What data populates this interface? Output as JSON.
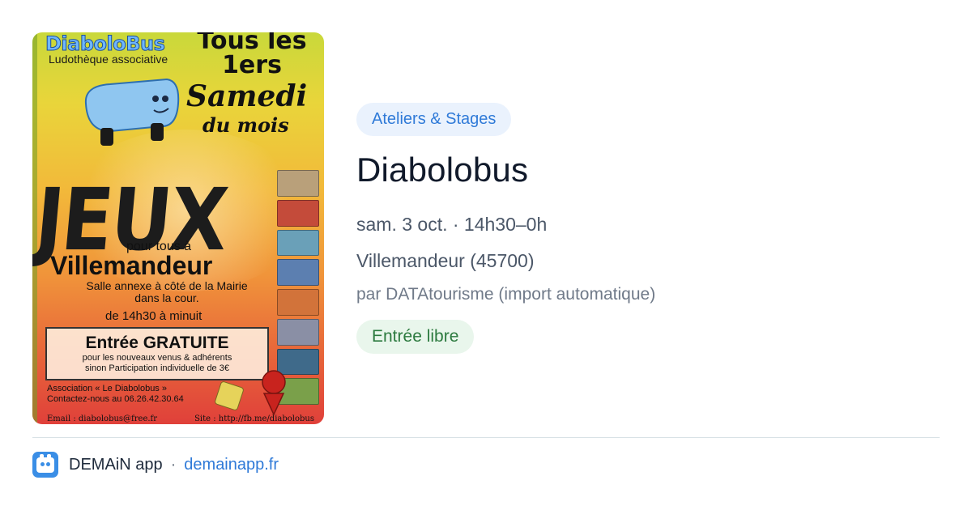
{
  "poster": {
    "logo_text": "DiaboloBus",
    "subtitle": "Ludothèque associative",
    "when_line1": "Tous les",
    "when_line2": "1ers",
    "when_line3": "Samedi",
    "when_line4": "du mois",
    "headline": "JEUX",
    "for_all": "pour tous à",
    "town": "Villemandeur",
    "venue_line1": "Salle annexe à côté de la Mairie",
    "venue_line2": "dans la cour.",
    "hours": "de 14h30 à minuit",
    "entry_title": "Entrée GRATUITE",
    "entry_line1": "pour les nouveaux venus & adhérents",
    "entry_line2": "sinon Participation individuelle de 3€",
    "assoc_line1": "Association « Le Diabolobus »",
    "assoc_line2": "Contactez-nous au 06.26.42.30.64",
    "email": "Email :  diabolobus@free.fr",
    "site": "Site : http://fb.me/diabolobus",
    "colors": {
      "background_top": "#c9d83a",
      "background_bottom": "#e0403a"
    }
  },
  "event": {
    "category": "Ateliers & Stages",
    "title": "Diabolobus",
    "datetime": "sam. 3 oct. · 14h30–0h",
    "location": "Villemandeur (45700)",
    "organizer": "par DATAtourisme (import automatique)",
    "price": "Entrée libre"
  },
  "footer": {
    "app_name": "DEMAiN app",
    "separator": "·",
    "link": "demainapp.fr",
    "icon": "demain-app-icon"
  },
  "colors": {
    "accent_blue": "#2f7ad8",
    "category_bg": "#eaf2fd",
    "price_bg": "#e9f6ec",
    "price_text": "#2c7a3f"
  }
}
